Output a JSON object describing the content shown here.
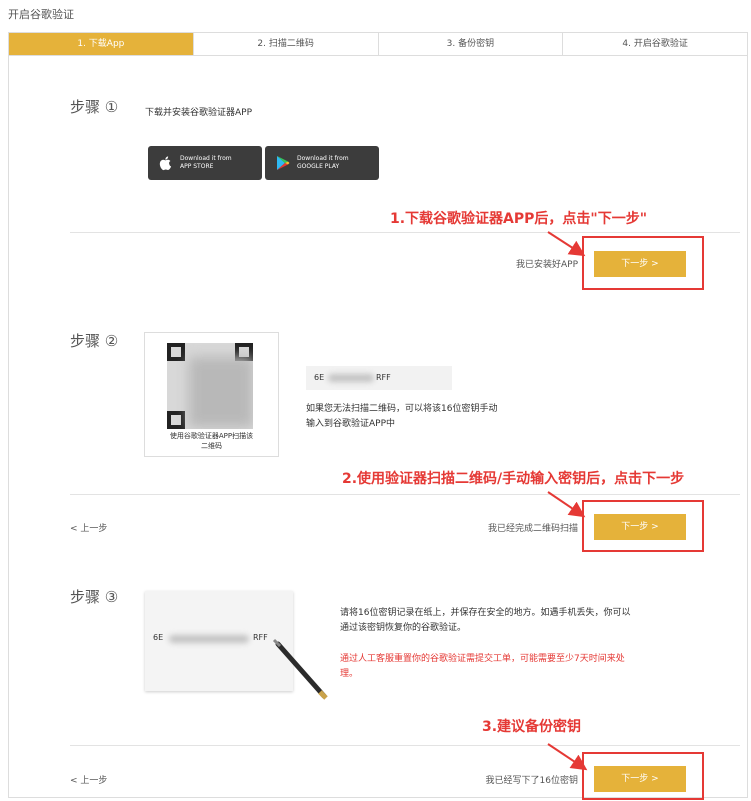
{
  "page_title": "开启谷歌验证",
  "tabs": [
    "1. 下载App",
    "2. 扫描二维码",
    "3. 备份密钥",
    "4. 开启谷歌验证"
  ],
  "step1": {
    "label": "步骤 ①",
    "text": "下载并安装谷歌验证器APP",
    "appstore_text": "Download it from\nAPP STORE",
    "googleplay_text": "Download it from\nGOOGLE PLAY",
    "status": "我已安装好APP",
    "next": "下一步 >"
  },
  "step2": {
    "label": "步骤 ②",
    "qr_caption": "使用谷歌验证器APP扫描该\n二维码",
    "key_prefix": "6E",
    "key_suffix": "RFF",
    "hint": "如果您无法扫描二维码，可以将该16位密钥手动\n输入到谷歌验证APP中",
    "prev": "< 上一步",
    "status": "我已经完成二维码扫描",
    "next": "下一步 >"
  },
  "step3": {
    "label": "步骤 ③",
    "key_prefix": "6E",
    "key_suffix": "RFF",
    "text": "请将16位密钥记录在纸上，并保存在安全的地方。如遇手机丢失，你可以\n通过该密钥恢复你的谷歌验证。",
    "warning": "通过人工客服重置你的谷歌验证需提交工单，可能需要至少7天时间来处\n理。",
    "prev": "< 上一步",
    "status": "我已经写下了16位密钥",
    "next": "下一步 >"
  },
  "annotations": [
    "1.下载谷歌验证器APP后，点击\"下一步\"",
    "2.使用验证器扫描二维码/手动输入密钥后，点击下一步",
    "3.建议备份密钥"
  ],
  "colors": {
    "accent": "#E5B23A",
    "annotation": "#E53935"
  }
}
